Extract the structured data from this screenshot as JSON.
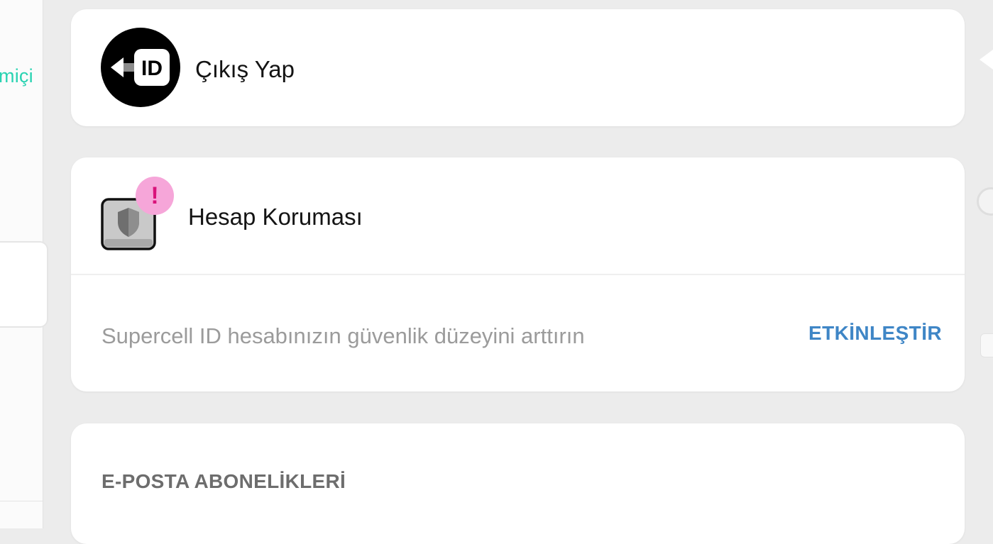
{
  "side_panel": {
    "status_text_partial": "miçi"
  },
  "logout": {
    "icon": "logout-id-icon",
    "icon_text": "ID",
    "label": "Çıkış Yap"
  },
  "account_protection": {
    "icon": "shield-icon",
    "badge_icon": "alert-icon",
    "badge_text": "!",
    "title": "Hesap Koruması",
    "description": "Supercell ID hesabınızın güvenlik düzeyini arttırın",
    "activate_label": "ETKİNLEŞTİR"
  },
  "email_subscriptions": {
    "heading": "E-POSTA ABONELİKLERİ"
  },
  "colors": {
    "background": "#ececec",
    "card": "#ffffff",
    "accent_link": "#3f86c6",
    "status_teal": "#2ad3b2",
    "badge_pink": "#f6a6d9"
  }
}
